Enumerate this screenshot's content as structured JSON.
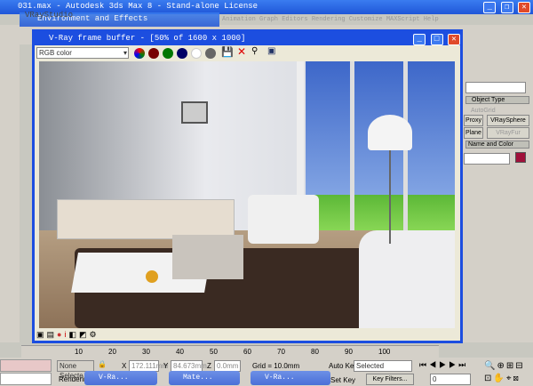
{
  "app_title": "031.max - Autodesk 3ds Max 8 - Stand-alone License",
  "bg_windows": {
    "vraystudio": "VRayStudio",
    "env": "Environment and Effects",
    "menu": "Animation  Graph Editors  Rendering  Customize  MAXScript  Help"
  },
  "vfb": {
    "title": "V-Ray frame buffer - [50% of 1600 x 1000]",
    "channel": "RGB color"
  },
  "right_panel": {
    "object_type": "Object Type",
    "autogrid": "AutoGrid",
    "proxy": "Proxy",
    "vraysphere": "VRaySphere",
    "plane": "Plane",
    "vrayfur": "VRayFur",
    "name_color": "Name and Color",
    "color": "#a0103a"
  },
  "timeline": {
    "ticks": [
      "10",
      "20",
      "30",
      "40",
      "50",
      "60",
      "70",
      "80",
      "90",
      "100"
    ]
  },
  "status": {
    "selection": "None Selecte",
    "rendering": "Rendering",
    "x": "172.111mm",
    "y": "84.673mm",
    "z": "0.0mm",
    "x_label": "X",
    "y_label": "Y",
    "z_label": "Z",
    "grid": "Grid = 10.0mm",
    "auto_key": "Auto Key",
    "set_key": "Set Key",
    "selected": "Selected",
    "key_filters": "Key Filters...",
    "frame": "0"
  },
  "taskbar": [
    {
      "label": "V-Ra..."
    },
    {
      "label": "Mate..."
    },
    {
      "label": "V-Ra..."
    }
  ]
}
